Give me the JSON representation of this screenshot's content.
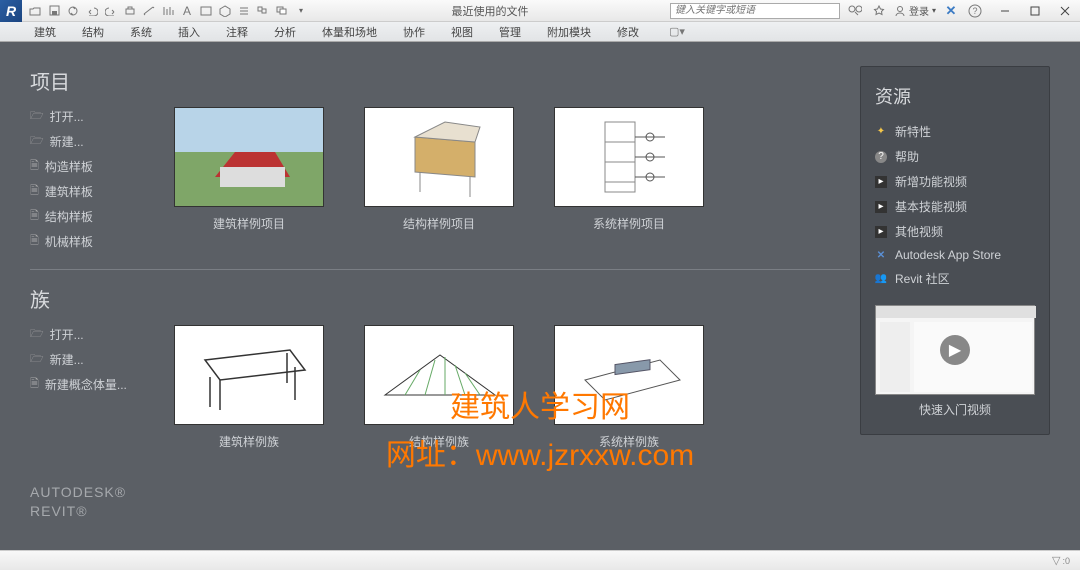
{
  "titlebar": {
    "app_letter": "R",
    "title": "最近使用的文件",
    "search_placeholder": "键入关键字或短语",
    "login": "登录"
  },
  "ribbon": {
    "tabs": [
      "建筑",
      "结构",
      "系统",
      "插入",
      "注释",
      "分析",
      "体量和场地",
      "协作",
      "视图",
      "管理",
      "附加模块",
      "修改"
    ]
  },
  "sections": {
    "project": {
      "title": "项目",
      "links": [
        "打开...",
        "新建...",
        "构造样板",
        "建筑样板",
        "结构样板",
        "机械样板"
      ],
      "tiles": [
        "建筑样例项目",
        "结构样例项目",
        "系统样例项目"
      ]
    },
    "family": {
      "title": "族",
      "links": [
        "打开...",
        "新建...",
        "新建概念体量..."
      ],
      "tiles": [
        "建筑样例族",
        "结构样例族",
        "系统样例族"
      ]
    }
  },
  "resources": {
    "title": "资源",
    "items": [
      "新特性",
      "帮助",
      "新增功能视频",
      "基本技能视频",
      "其他视频",
      "Autodesk App Store",
      "Revit 社区"
    ],
    "video_label": "快速入门视频"
  },
  "brand": {
    "line1": "AUTODESK®",
    "line2": "REVIT®"
  },
  "watermark": {
    "line1": "建筑人学习网",
    "line2": "网址：www.jzrxxw.com"
  },
  "statusbar": {
    "filter": "▽"
  }
}
